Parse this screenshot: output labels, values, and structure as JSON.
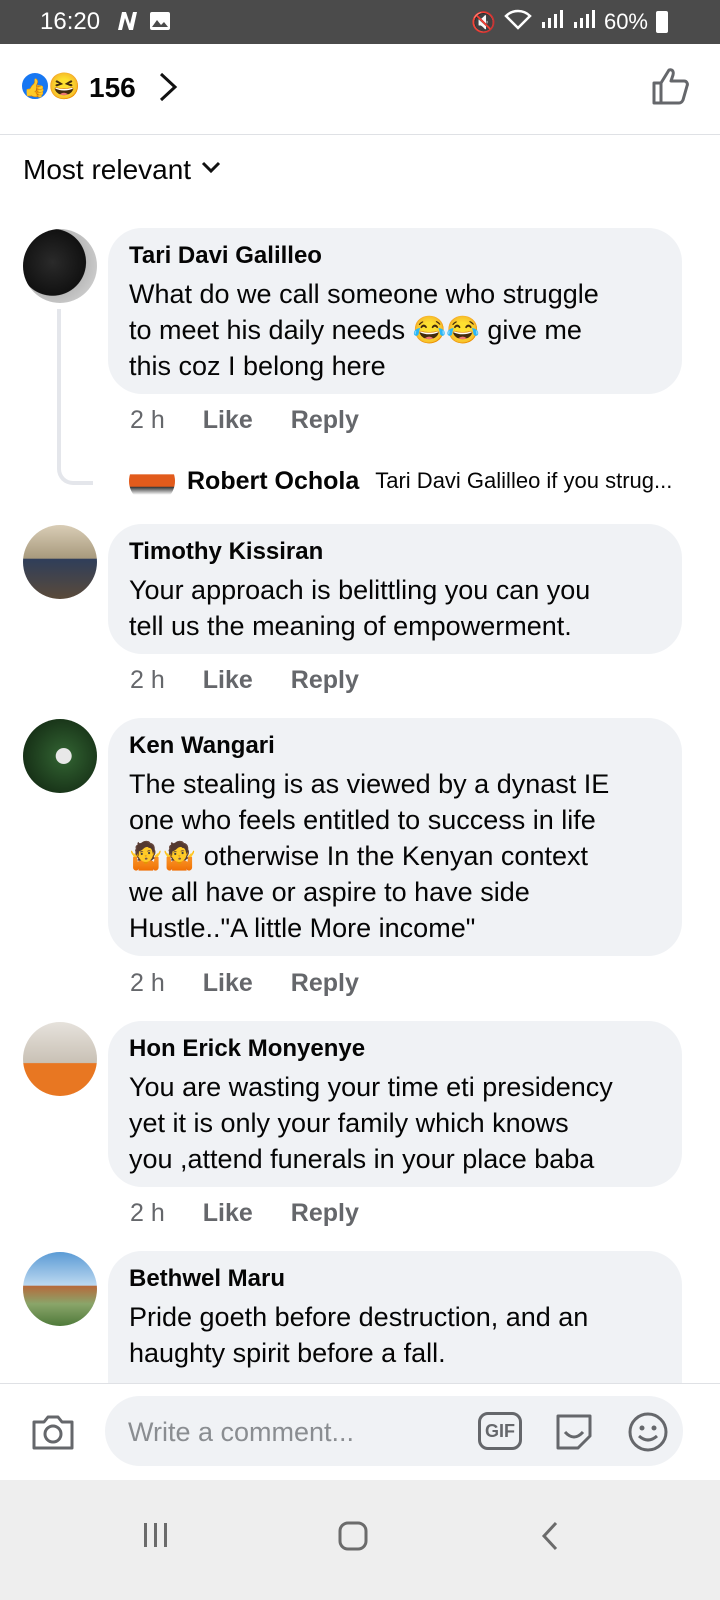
{
  "status_bar": {
    "time": "16:20",
    "battery": "60%"
  },
  "reactions": {
    "count": "156"
  },
  "sort": {
    "label": "Most relevant"
  },
  "comments": [
    {
      "name": "Tari Davi Galilleo",
      "lines": [
        "What do we call someone who struggle",
        "to meet his daily needs 😂😂 give me",
        "this coz I belong here"
      ],
      "time": "2 h",
      "like": "Like",
      "reply": "Reply"
    },
    {
      "name": "Timothy Kissiran",
      "lines": [
        "Your approach is belittling you can you",
        "tell us the meaning of empowerment."
      ],
      "time": "2 h",
      "like": "Like",
      "reply": "Reply"
    },
    {
      "name": "Ken Wangari",
      "lines": [
        "The stealing is as viewed by a dynast IE",
        "one who feels entitled to success in life",
        "🤷🤷 otherwise In the Kenyan context",
        "we all have or aspire to have side",
        "Hustle..\"A little More income\""
      ],
      "time": "2 h",
      "like": "Like",
      "reply": "Reply"
    },
    {
      "name": "Hon Erick Monyenye",
      "lines": [
        "You are wasting your time eti presidency",
        "yet it is only your family which knows",
        "you ,attend funerals in your place baba"
      ],
      "time": "2 h",
      "like": "Like",
      "reply": "Reply"
    },
    {
      "name": "Bethwel Maru",
      "lines": [
        "Pride goeth before destruction, and an",
        "haughty spirit before a fall."
      ]
    }
  ],
  "reply_preview": {
    "name": "Robert Ochola",
    "text": "Tari Davi Galilleo if you strug..."
  },
  "composer": {
    "placeholder": "Write a comment...",
    "gif_label": "GIF"
  }
}
